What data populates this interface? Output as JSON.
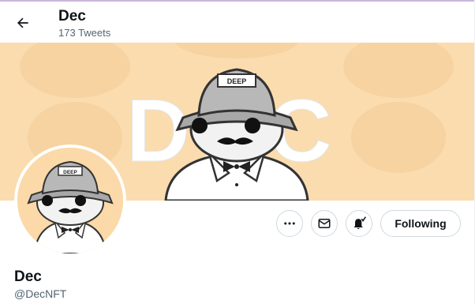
{
  "header": {
    "title": "Dec",
    "tweet_count": "173 Tweets"
  },
  "banner": {
    "big_text": "DEC",
    "hat_text": "DEEP",
    "background": "#fbdcae"
  },
  "avatar": {
    "hat_text": "DEEP",
    "background": "#fbd9a8"
  },
  "actions": {
    "more_icon": "more-icon",
    "message_icon": "mail-icon",
    "notify_icon": "bell-check-icon",
    "following_label": "Following"
  },
  "profile": {
    "name": "Dec",
    "handle": "@DecNFT"
  }
}
